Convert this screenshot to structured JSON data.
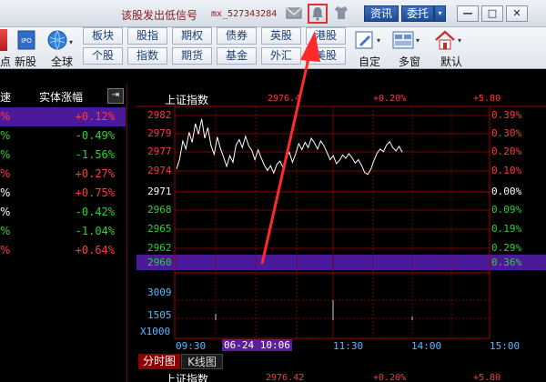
{
  "titlebar": {
    "signal_text": "该股发出低信号",
    "user_id": "mx_527343284",
    "info_label": "资讯",
    "trade_label": "委托",
    "trade_dropdown": "▾",
    "min_label": "—",
    "max_label": "□",
    "close_label": "✕"
  },
  "toolbar": {
    "buttons_row1": [
      "板块",
      "股指",
      "期权",
      "债券",
      "英股",
      "港股"
    ],
    "buttons_row2": [
      "个股",
      "指数",
      "期货",
      "基金",
      "外汇",
      "美股"
    ],
    "labels": {
      "point": "点",
      "new_stock": "新股",
      "global": "全球",
      "custom": "自定",
      "multi_window": "多窗",
      "default": "默认"
    }
  },
  "left_panel": {
    "header_col1": "速",
    "header_col2": "实体涨幅",
    "rows": [
      {
        "col1": "%",
        "change": "+0.12%",
        "dir": "up",
        "selected": true
      },
      {
        "col1": "%",
        "change": "-0.49%",
        "dir": "down"
      },
      {
        "col1": "%",
        "change": "-1.56%",
        "dir": "down"
      },
      {
        "col1": "%",
        "change": "+0.27%",
        "dir": "up"
      },
      {
        "col1": "%",
        "change": "+0.75%",
        "dir": "up"
      },
      {
        "col1": "%",
        "change": "-0.42%",
        "dir": "down"
      },
      {
        "col1": "%",
        "change": "-1.04%",
        "dir": "down"
      },
      {
        "col1": "%",
        "change": "+0.64%",
        "dir": "up"
      }
    ]
  },
  "chart": {
    "index_name": "上证指数",
    "price": "2976.4",
    "pct": "+0.20%",
    "delta": "+5.80",
    "y_left": [
      "2982",
      "2979",
      "2977",
      "2974",
      "2971",
      "2968",
      "2965",
      "2962",
      "2960"
    ],
    "y_right": [
      "0.39%",
      "0.30%",
      "0.20%",
      "0.10%",
      "0.00%",
      "0.09%",
      "0.19%",
      "0.29%",
      "0.36%"
    ],
    "vol_labels": [
      "3009",
      "1505"
    ],
    "vol_unit": "X1000",
    "x_labels": [
      "09:30",
      "06-24 10:06",
      "11:30",
      "14:00",
      "15:00"
    ],
    "tabs": [
      "分时图",
      "K线图"
    ],
    "footer_name": "上证指数",
    "footer_price": "2976.42",
    "footer_pct": "+0.20%",
    "footer_delta": "+5.80",
    "series": [
      2974.0,
      2975.5,
      2978.2,
      2977.0,
      2979.5,
      2978.0,
      2980.8,
      2979.2,
      2981.5,
      2978.6,
      2980.2,
      2977.5,
      2976.2,
      2978.8,
      2977.1,
      2975.8,
      2974.4,
      2976.0,
      2975.0,
      2977.6,
      2978.4,
      2977.2,
      2978.9,
      2977.5,
      2976.8,
      2975.4,
      2976.9,
      2975.7,
      2974.6,
      2973.8,
      2974.5,
      2973.4,
      2974.7,
      2975.2,
      2974.2,
      2975.9,
      2976.5,
      2975.0,
      2976.3,
      2977.8,
      2976.9,
      2978.0,
      2977.2,
      2978.6,
      2977.9,
      2977.0,
      2978.2,
      2977.5,
      2976.5,
      2975.4,
      2976.0,
      2974.8,
      2975.3,
      2976.1,
      2975.6,
      2976.3,
      2975.7,
      2974.9,
      2975.4,
      2974.6,
      2973.5,
      2973.2,
      2974.0,
      2975.3,
      2976.4,
      2977.0,
      2976.6,
      2977.6,
      2978.1,
      2977.2,
      2976.7,
      2977.4,
      2976.5
    ]
  }
}
